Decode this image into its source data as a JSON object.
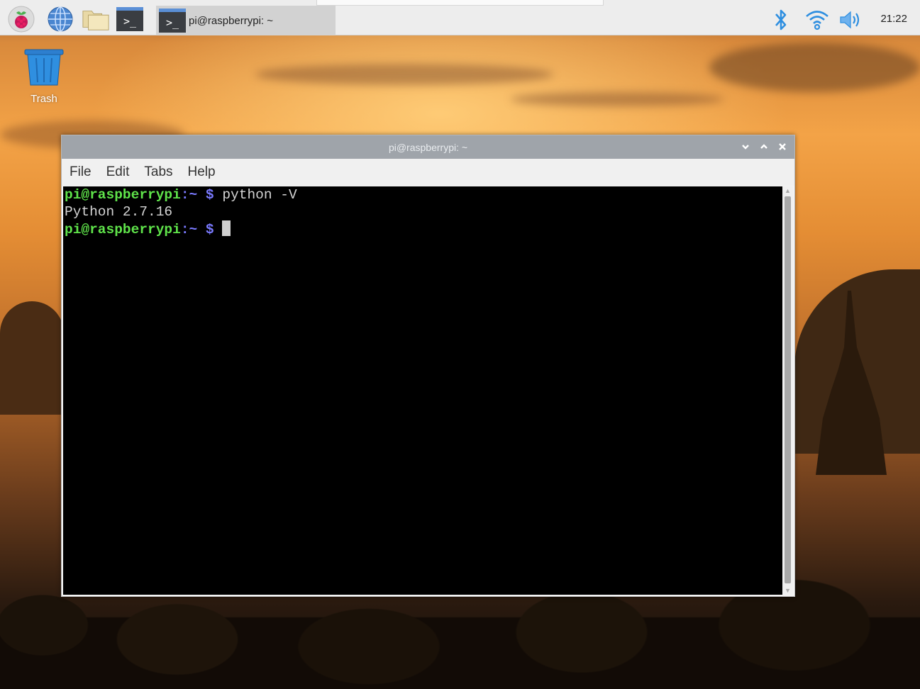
{
  "panel": {
    "launchers": [
      {
        "icon": "raspberry-menu-icon"
      },
      {
        "icon": "web-browser-icon"
      },
      {
        "icon": "file-manager-icon"
      },
      {
        "icon": "terminal-icon",
        "glyph": ">_"
      }
    ],
    "taskbar": {
      "label": "pi@raspberrypi: ~",
      "glyph": ">_"
    },
    "tray": {
      "bluetooth": "bluetooth-icon",
      "wifi": "wifi-icon",
      "volume": "volume-icon"
    },
    "clock": "21:22",
    "accent_color": "#2f8fe0"
  },
  "desktop": {
    "icons": [
      {
        "label": "Trash",
        "icon": "trash-icon"
      }
    ]
  },
  "window": {
    "title": "pi@raspberrypi: ~",
    "menu": [
      "File",
      "Edit",
      "Tabs",
      "Help"
    ],
    "terminal": {
      "prompt_user": "pi@raspberrypi",
      "prompt_path": ":~",
      "prompt_symbol": " $",
      "command": " python -V",
      "output": "Python 2.7.16",
      "colors": {
        "user": "#5fe34a",
        "path": "#7a7aff",
        "text": "#d4d4d4",
        "background": "#000000"
      }
    }
  }
}
